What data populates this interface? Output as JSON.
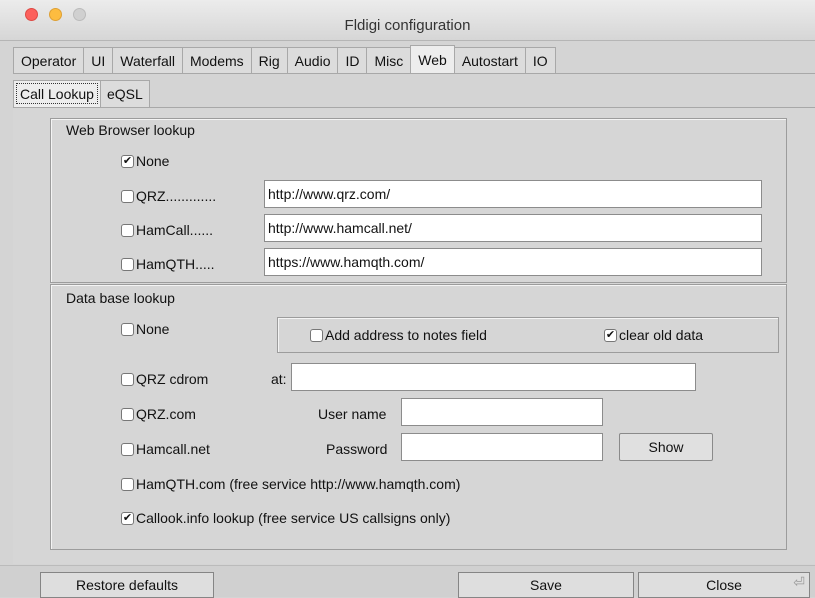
{
  "window": {
    "title": "Fldigi configuration"
  },
  "tabs": [
    {
      "label": "Operator",
      "active": false
    },
    {
      "label": "UI",
      "active": false
    },
    {
      "label": "Waterfall",
      "active": false
    },
    {
      "label": "Modems",
      "active": false
    },
    {
      "label": "Rig",
      "active": false
    },
    {
      "label": "Audio",
      "active": false
    },
    {
      "label": "ID",
      "active": false
    },
    {
      "label": "Misc",
      "active": false
    },
    {
      "label": "Web",
      "active": true
    },
    {
      "label": "Autostart",
      "active": false
    },
    {
      "label": "IO",
      "active": false
    }
  ],
  "subtabs": [
    {
      "label": "Call Lookup",
      "active": true
    },
    {
      "label": "eQSL",
      "active": false
    }
  ],
  "web_browser": {
    "title": "Web Browser lookup",
    "none": {
      "label": "None",
      "checked": true
    },
    "qrz": {
      "label": "QRZ.............",
      "checked": false,
      "url": "http://www.qrz.com/"
    },
    "hamcall": {
      "label": "HamCall......",
      "checked": false,
      "url": "http://www.hamcall.net/"
    },
    "hamqth": {
      "label": "HamQTH.....",
      "checked": false,
      "url": "https://www.hamqth.com/"
    }
  },
  "database": {
    "title": "Data base lookup",
    "none": {
      "label": "None",
      "checked": false
    },
    "add_address": {
      "label": "Add address to notes field",
      "checked": false
    },
    "clear_old": {
      "label": "clear old data",
      "checked": true
    },
    "qrz_cdrom": {
      "label": "QRZ cdrom",
      "checked": false
    },
    "at_label": "at:",
    "at_value": "",
    "qrz_com": {
      "label": "QRZ.com",
      "checked": false
    },
    "username_label": "User name",
    "username_value": "",
    "hamcall_net": {
      "label": "Hamcall.net",
      "checked": false
    },
    "password_label": "Password",
    "password_value": "",
    "show_label": "Show",
    "hamqth_com": {
      "label": "HamQTH.com (free service http://www.hamqth.com)",
      "checked": false
    },
    "callook": {
      "label": "Callook.info lookup (free service US callsigns only)",
      "checked": true
    }
  },
  "footer": {
    "restore": "Restore defaults",
    "save": "Save",
    "close": "Close"
  },
  "colors": {
    "panel": "#d6d6d6",
    "input_bg": "#ffffff",
    "close_light": "#fc605c",
    "min_light": "#fdbc40"
  }
}
